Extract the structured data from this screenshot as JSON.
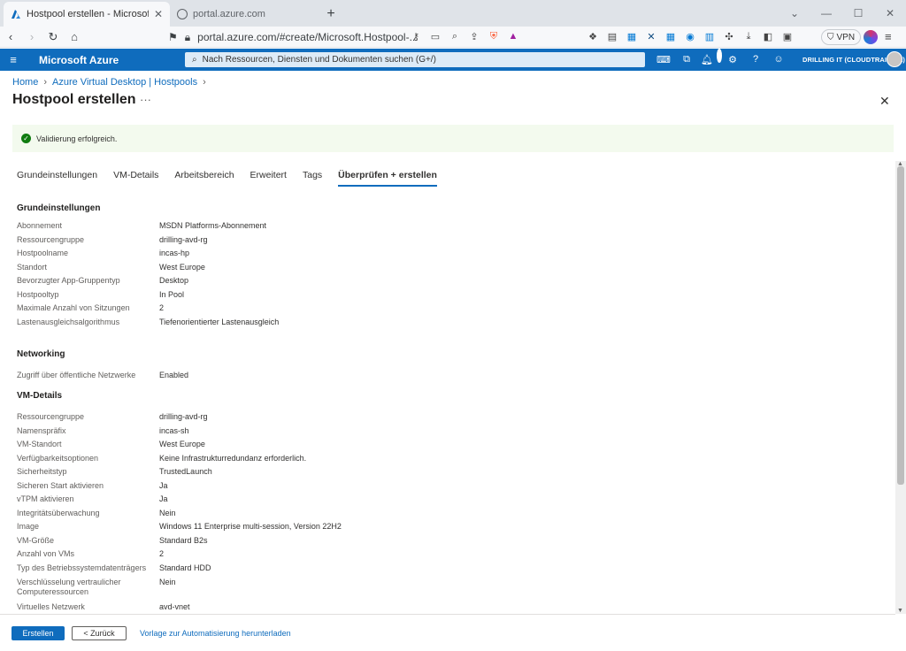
{
  "browser": {
    "active_tab_title": "Hostpool erstellen - Microsoft Azure",
    "inactive_tab_title": "portal.azure.com",
    "address": "portal.azure.com/#create/Microsoft.Hostpool-...",
    "vpn_label": "VPN"
  },
  "azure": {
    "brand": "Microsoft Azure",
    "search_placeholder": "Nach Ressourcen, Diensten und Dokumenten suchen (G+/)",
    "notification_count": "3",
    "tenant": "DRILLING IT (CLOUDTRAIN.DE)"
  },
  "breadcrumb": [
    "Home",
    "Azure Virtual Desktop | Hostpools"
  ],
  "page": {
    "title": "Hostpool erstellen",
    "validation_message": "Validierung erfolgreich."
  },
  "tabs": [
    "Grundeinstellungen",
    "VM-Details",
    "Arbeitsbereich",
    "Erweitert",
    "Tags",
    "Überprüfen + erstellen"
  ],
  "active_tab": "Überprüfen + erstellen",
  "sections": [
    {
      "title": "Grundeinstellungen",
      "rows": [
        {
          "key": "Abonnement",
          "value": "MSDN Platforms-Abonnement"
        },
        {
          "key": "Ressourcengruppe",
          "value": "drilling-avd-rg"
        },
        {
          "key": "Hostpoolname",
          "value": "incas-hp"
        },
        {
          "key": "Standort",
          "value": "West Europe"
        },
        {
          "key": "Bevorzugter App-Gruppentyp",
          "value": "Desktop"
        },
        {
          "key": "Hostpooltyp",
          "value": "In Pool"
        },
        {
          "key": "Maximale Anzahl von Sitzungen",
          "value": "2"
        },
        {
          "key": "Lastenausgleichsalgorithmus",
          "value": "Tiefenorientierter Lastenausgleich"
        }
      ]
    },
    {
      "title": "Networking",
      "rows": [
        {
          "key": "Zugriff über öffentliche Netzwerke",
          "value": "Enabled"
        }
      ]
    },
    {
      "title": "VM-Details",
      "rows": [
        {
          "key": "Ressourcengruppe",
          "value": "drilling-avd-rg"
        },
        {
          "key": "Namenspräfix",
          "value": "incas-sh"
        },
        {
          "key": "VM-Standort",
          "value": "West Europe"
        },
        {
          "key": "Verfügbarkeitsoptionen",
          "value": "Keine Infrastrukturredundanz erforderlich."
        },
        {
          "key": "Sicherheitstyp",
          "value": "TrustedLaunch"
        },
        {
          "key": "Sicheren Start aktivieren",
          "value": "Ja"
        },
        {
          "key": "vTPM aktivieren",
          "value": "Ja"
        },
        {
          "key": "Integritätsüberwachung",
          "value": "Nein"
        },
        {
          "key": "Image",
          "value": "Windows 11 Enterprise multi-session, Version 22H2"
        },
        {
          "key": "VM-Größe",
          "value": "Standard B2s"
        },
        {
          "key": "Anzahl von VMs",
          "value": "2"
        },
        {
          "key": "Typ des Betriebssystemdatenträgers",
          "value": "Standard HDD"
        },
        {
          "key": "Verschlüsselung vertraulicher Computeressourcen",
          "value": "Nein"
        },
        {
          "key": "Virtuelles Netzwerk",
          "value": "avd-vnet"
        }
      ]
    }
  ],
  "footer": {
    "create_label": "Erstellen",
    "back_label": "< Zurück",
    "download_label": "Vorlage zur Automatisierung herunterladen"
  }
}
